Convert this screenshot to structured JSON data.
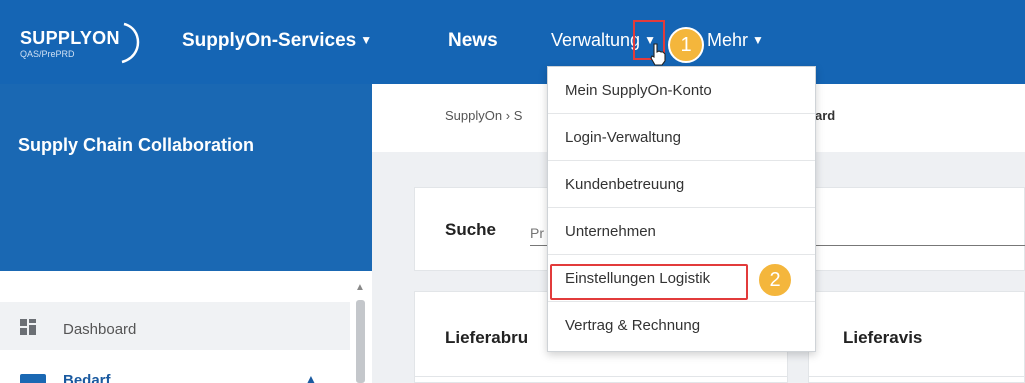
{
  "header": {
    "logo_text": "SUPPLYON",
    "logo_sub": "QAS/PrePRD",
    "nav": {
      "services": "SupplyOn-Services",
      "news": "News",
      "verwaltung": "Verwaltung",
      "mehr": "Mehr"
    },
    "caret": "▼",
    "brand_color": "#1565b4"
  },
  "annotations": {
    "step_1": "1",
    "step_2": "2",
    "highlight_color": "#e23b3b",
    "badge_color": "#f4b63c"
  },
  "dropdown": {
    "items": [
      {
        "label": "Mein SupplyOn-Konto"
      },
      {
        "label": "Login-Verwaltung"
      },
      {
        "label": "Kundenbetreuung"
      },
      {
        "label": "Unternehmen"
      },
      {
        "label": "Einstellungen Logistik"
      },
      {
        "label": "Vertrag & Rechnung"
      }
    ]
  },
  "sidebar": {
    "title": "Supply Chain Collaboration",
    "items": [
      {
        "label": "Dashboard",
        "icon": "dashboard-icon"
      },
      {
        "label": "Bedarf",
        "icon": "folder-icon"
      }
    ]
  },
  "breadcrumb": {
    "root": "SupplyOn",
    "separator": "›",
    "partial": "S",
    "tail": "ard"
  },
  "search": {
    "label": "Suche",
    "placeholder": "Pr"
  },
  "cards": {
    "left_title": "Lieferabru",
    "right_title": "Lieferavis"
  }
}
